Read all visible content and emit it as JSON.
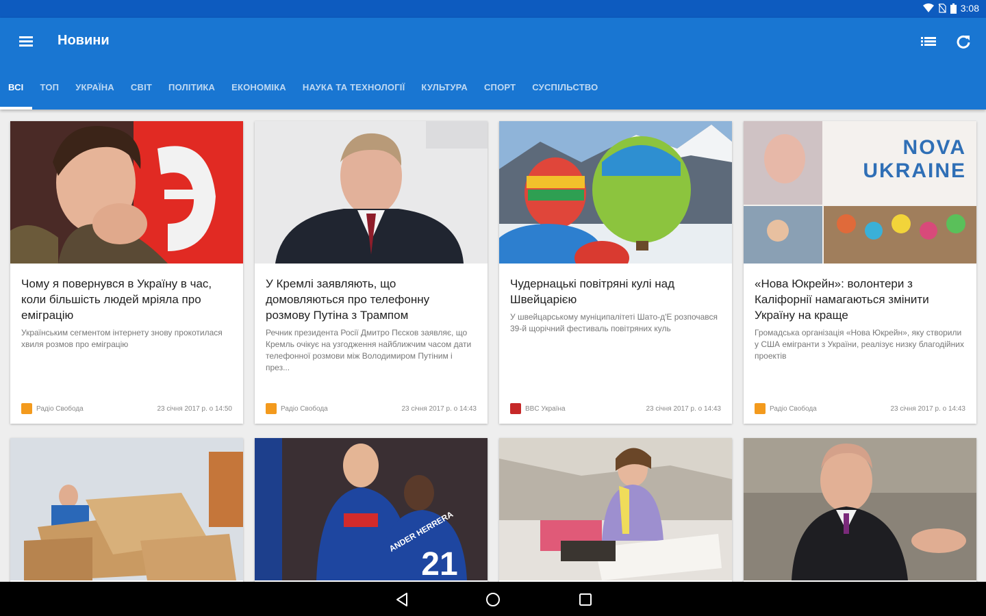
{
  "status_bar": {
    "time": "3:08",
    "icons": [
      "wifi-icon",
      "no-sim-icon",
      "battery-icon"
    ]
  },
  "app_bar": {
    "title": "Новини",
    "menu_icon": "hamburger-menu-icon",
    "actions": [
      "view-list-icon",
      "refresh-icon"
    ]
  },
  "tabs": [
    {
      "label": "ВСІ",
      "active": true
    },
    {
      "label": "ТОП"
    },
    {
      "label": "УКРАЇНА"
    },
    {
      "label": "СВІТ"
    },
    {
      "label": "ПОЛІТИКА"
    },
    {
      "label": "ЕКОНОМІКА"
    },
    {
      "label": "НАУКА ТА ТЕХНОЛОГІЇ"
    },
    {
      "label": "КУЛЬТУРА"
    },
    {
      "label": "СПОРТ"
    },
    {
      "label": "СУСПІЛЬСТВО"
    }
  ],
  "articles": [
    {
      "headline": "Чому я повернувся в Україну в час, коли більшість людей мріяла про еміграцію",
      "summary": "Українським сегментом інтернету знову прокотилася хвиля розмов про еміграцію",
      "source": "Радіо Свобода",
      "date": "23 січня 2017 р. о 14:50"
    },
    {
      "headline": "У Кремлі заявляють, що домовляються про телефонну розмову Путіна з Трампом",
      "summary": "Речник президента Росії Дмитро Пєсков заявляє, що Кремль очікує на узгодження найближчим часом дати телефонної розмови між Володимиром Путіним і през...",
      "source": "Радіо Свобода",
      "date": "23 січня 2017 р. о 14:43"
    },
    {
      "headline": "Чудернацькі повітряні кулі над Швейцарією",
      "summary": "У швейцарському муніципалітеті Шато-д'Е розпочався 39-й щорічний фестиваль повітряних куль",
      "source": "BBC Україна",
      "date": "23 січня 2017 р. о 14:43"
    },
    {
      "headline": "«Нова Юкрейн»: волонтери з Каліфорнії намагаються змінити Україну на краще",
      "summary": "Громадська організація «Нова Юкрейн», яку створили у США емігранти з України, реалізує низку благодійних проектів",
      "source": "Радіо Свобода",
      "date": "23 січня 2017 р. о 14:43"
    }
  ],
  "image_texts": {
    "nova_line1": "NOVA",
    "nova_line2": "UKRAINE",
    "jersey_number": "21",
    "jersey_name": "ANDER HERRERA"
  },
  "nav_bar": [
    "back-icon",
    "home-icon",
    "recents-icon"
  ]
}
